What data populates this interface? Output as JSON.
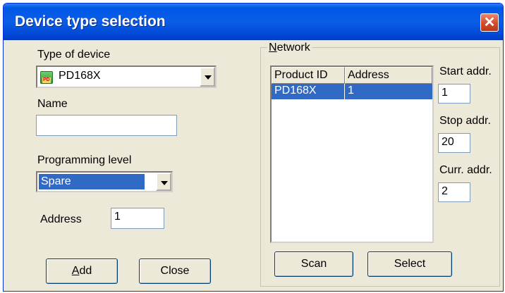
{
  "window": {
    "title": "Device type selection",
    "close_label": "✕"
  },
  "device_type": {
    "label": "Type of device",
    "value": "PD168X",
    "icon": "device-chip-icon"
  },
  "name": {
    "label": "Name",
    "value": ""
  },
  "programming_level": {
    "label": "Programming level",
    "value": "Spare"
  },
  "address": {
    "label": "Address",
    "value": "1"
  },
  "buttons": {
    "add_first": "A",
    "add_rest": "dd",
    "close": "Close",
    "scan": "Scan",
    "select": "Select"
  },
  "network": {
    "title_first": "N",
    "title_rest": "etwork",
    "columns": [
      "Product ID",
      "Address"
    ],
    "rows": [
      {
        "product_id": "PD168X",
        "address": "1"
      }
    ],
    "start_addr": {
      "label": "Start addr.",
      "value": "1"
    },
    "stop_addr": {
      "label": "Stop addr.",
      "value": "20"
    },
    "curr_addr": {
      "label": "Curr. addr.",
      "value": "2"
    }
  },
  "colors": {
    "titlebar": "#0058e6",
    "selection": "#316ac5",
    "dialog_bg": "#ece9d8"
  }
}
